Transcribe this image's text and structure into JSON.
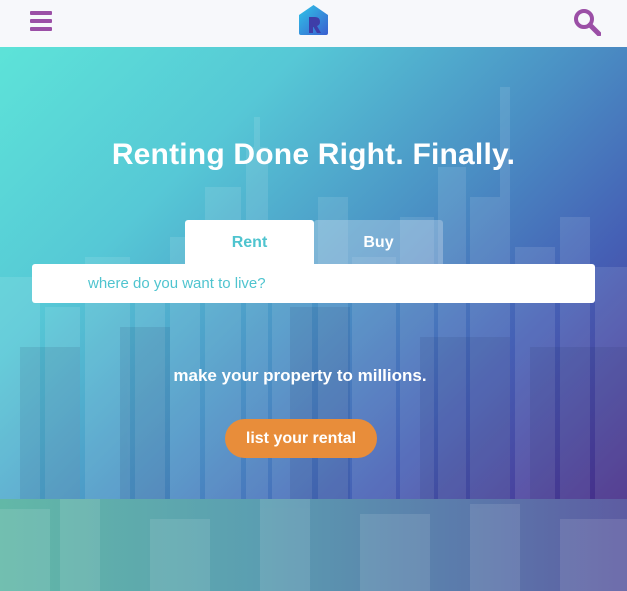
{
  "header": {
    "menu_icon": "hamburger-menu-icon",
    "logo_icon": "house-logo-icon",
    "search_icon": "search-icon"
  },
  "hero": {
    "headline": "Renting Done Right. Finally.",
    "tabs": [
      {
        "label": "Rent",
        "active": true
      },
      {
        "label": "Buy",
        "active": false
      }
    ],
    "search_placeholder": "where do you want to live?",
    "tagline": "make your property to millions.",
    "cta_label": "list your rental"
  },
  "colors": {
    "accent_purple": "#9b4fa6",
    "accent_teal": "#4fc4cf",
    "cta_orange": "#e88d3a"
  }
}
